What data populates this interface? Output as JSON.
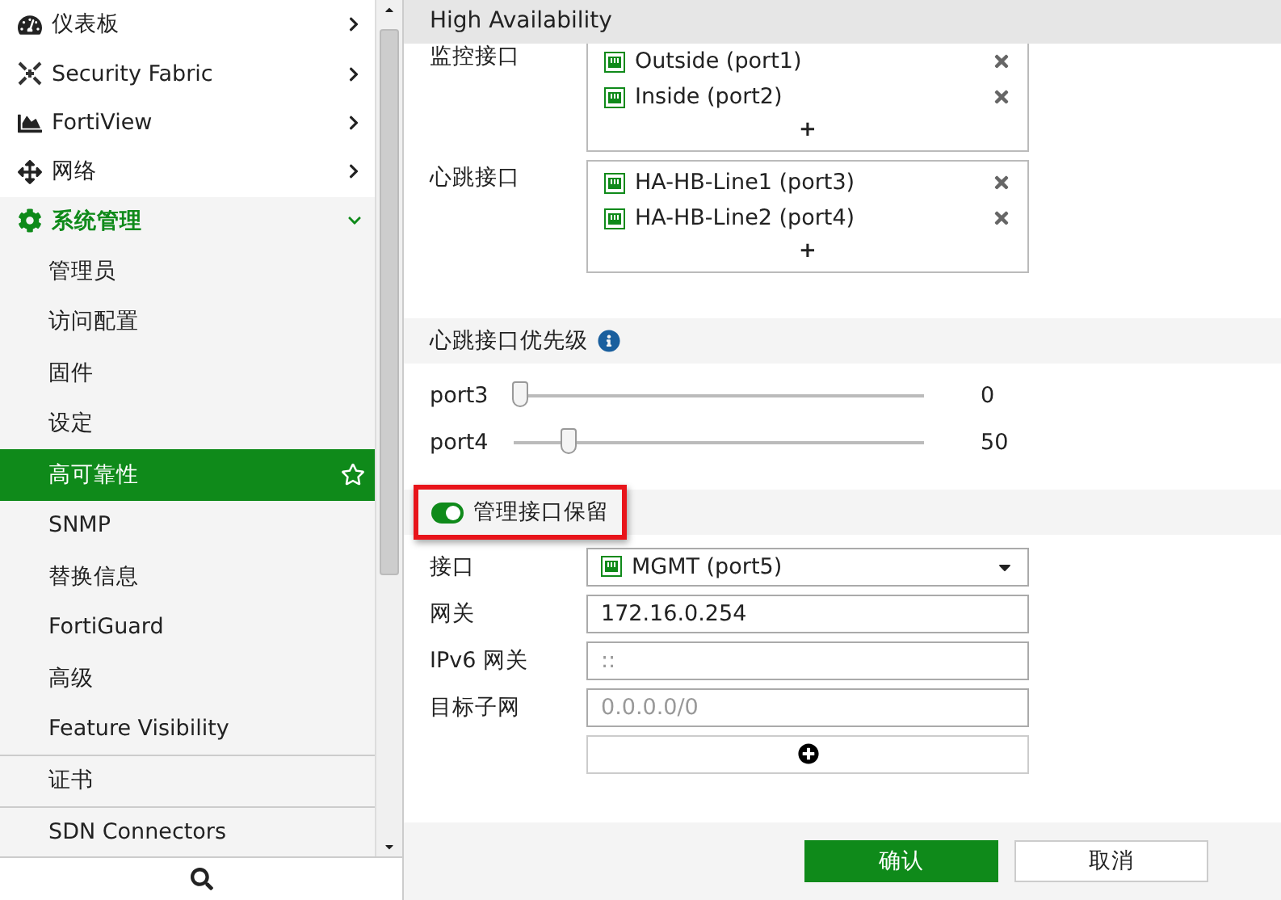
{
  "sidebar": {
    "items": [
      {
        "label": "仪表板",
        "expanded": false,
        "active": false
      },
      {
        "label": "Security Fabric",
        "expanded": false,
        "active": false
      },
      {
        "label": "FortiView",
        "expanded": false,
        "active": false
      },
      {
        "label": "网络",
        "expanded": false,
        "active": false
      },
      {
        "label": "系统管理",
        "expanded": true,
        "active": true,
        "children": [
          {
            "label": "管理员",
            "selected": false,
            "divider_before": false
          },
          {
            "label": "访问配置",
            "selected": false,
            "divider_before": false
          },
          {
            "label": "固件",
            "selected": false,
            "divider_before": false
          },
          {
            "label": "设定",
            "selected": false,
            "divider_before": false
          },
          {
            "label": "高可靠性",
            "selected": true,
            "divider_before": false
          },
          {
            "label": "SNMP",
            "selected": false,
            "divider_before": false
          },
          {
            "label": "替换信息",
            "selected": false,
            "divider_before": false
          },
          {
            "label": "FortiGuard",
            "selected": false,
            "divider_before": false
          },
          {
            "label": "高级",
            "selected": false,
            "divider_before": false
          },
          {
            "label": "Feature Visibility",
            "selected": false,
            "divider_before": false
          },
          {
            "label": "证书",
            "selected": false,
            "divider_before": true
          },
          {
            "label": "SDN Connectors",
            "selected": false,
            "divider_before": true
          }
        ]
      }
    ]
  },
  "panel": {
    "title": "High Availability",
    "interface_lists": [
      {
        "label": "监控接口",
        "items": [
          "Outside (port1)",
          "Inside (port2)"
        ],
        "add": "+"
      },
      {
        "label": "心跳接口",
        "items": [
          "HA-HB-Line1 (port3)",
          "HA-HB-Line2 (port4)"
        ],
        "add": "+"
      }
    ],
    "priority": {
      "title": "心跳接口优先级",
      "sliders": [
        {
          "name": "port3",
          "level": 0,
          "reading": "0"
        },
        {
          "name": "port4",
          "level": 0.12,
          "reading": "50"
        }
      ]
    },
    "management": {
      "title": "管理接口保留",
      "on": true,
      "highlighted": true,
      "fields": [
        {
          "kind": "select",
          "label": "接口",
          "value": "MGMT (port5)"
        },
        {
          "kind": "text",
          "label": "网关",
          "value": "172.16.0.254"
        },
        {
          "kind": "text",
          "label": "IPv6 网关",
          "placeholder": "::"
        },
        {
          "kind": "text",
          "label": "目标子网",
          "placeholder": "0.0.0.0/0"
        },
        {
          "kind": "add"
        }
      ]
    },
    "buttons": [
      {
        "label": "确认",
        "primary": true
      },
      {
        "label": "取消",
        "primary": false
      }
    ]
  }
}
